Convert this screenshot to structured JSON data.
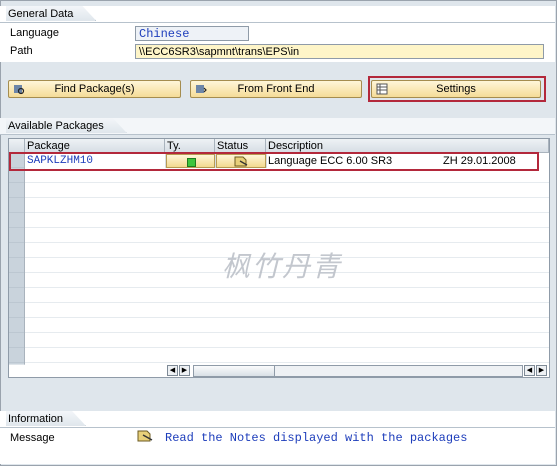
{
  "general": {
    "title": "General Data",
    "language_label": "Language",
    "language_value": "Chinese",
    "path_label": "Path",
    "path_value": "\\\\ECC6SR3\\sapmnt\\trans\\EPS\\in"
  },
  "buttons": {
    "find": "Find Package(s)",
    "front_end": "From Front End",
    "settings": "Settings"
  },
  "packages": {
    "title": "Available Packages",
    "columns": [
      "Package",
      "Ty.",
      "Status",
      "Description"
    ],
    "rows": [
      {
        "package": "SAPKLZHM10",
        "description": "Language ECC 6.00 SR3",
        "info": "ZH 29.01.2008"
      }
    ]
  },
  "information": {
    "title": "Information",
    "message_label": "Message",
    "message_text": "Read the Notes displayed with the packages"
  },
  "watermark": "枫竹丹青",
  "colors": {
    "highlight_box": "#b3283b",
    "status_green": "#3dc53d",
    "link_text": "#1d3dbb"
  }
}
